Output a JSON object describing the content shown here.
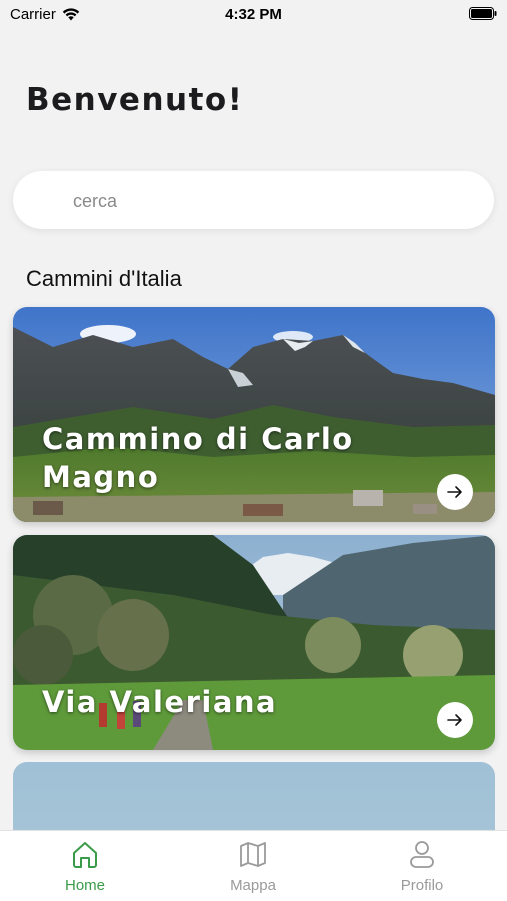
{
  "status_bar": {
    "carrier": "Carrier",
    "time": "4:32 PM"
  },
  "header": {
    "title": "Benvenuto!"
  },
  "search": {
    "placeholder": "cerca"
  },
  "section": {
    "title": "Cammini d'Italia"
  },
  "cards": [
    {
      "title": "Cammino di Carlo Magno"
    },
    {
      "title": "Via Valeriana"
    }
  ],
  "tab_bar": {
    "active": "Home",
    "tabs": [
      {
        "label": "Home",
        "icon": "home-icon"
      },
      {
        "label": "Mappa",
        "icon": "map-icon"
      },
      {
        "label": "Profilo",
        "icon": "profile-icon"
      }
    ]
  },
  "colors": {
    "accent": "#3a9b48",
    "inactive": "#9a9a9a",
    "background": "#f2f2f2"
  }
}
